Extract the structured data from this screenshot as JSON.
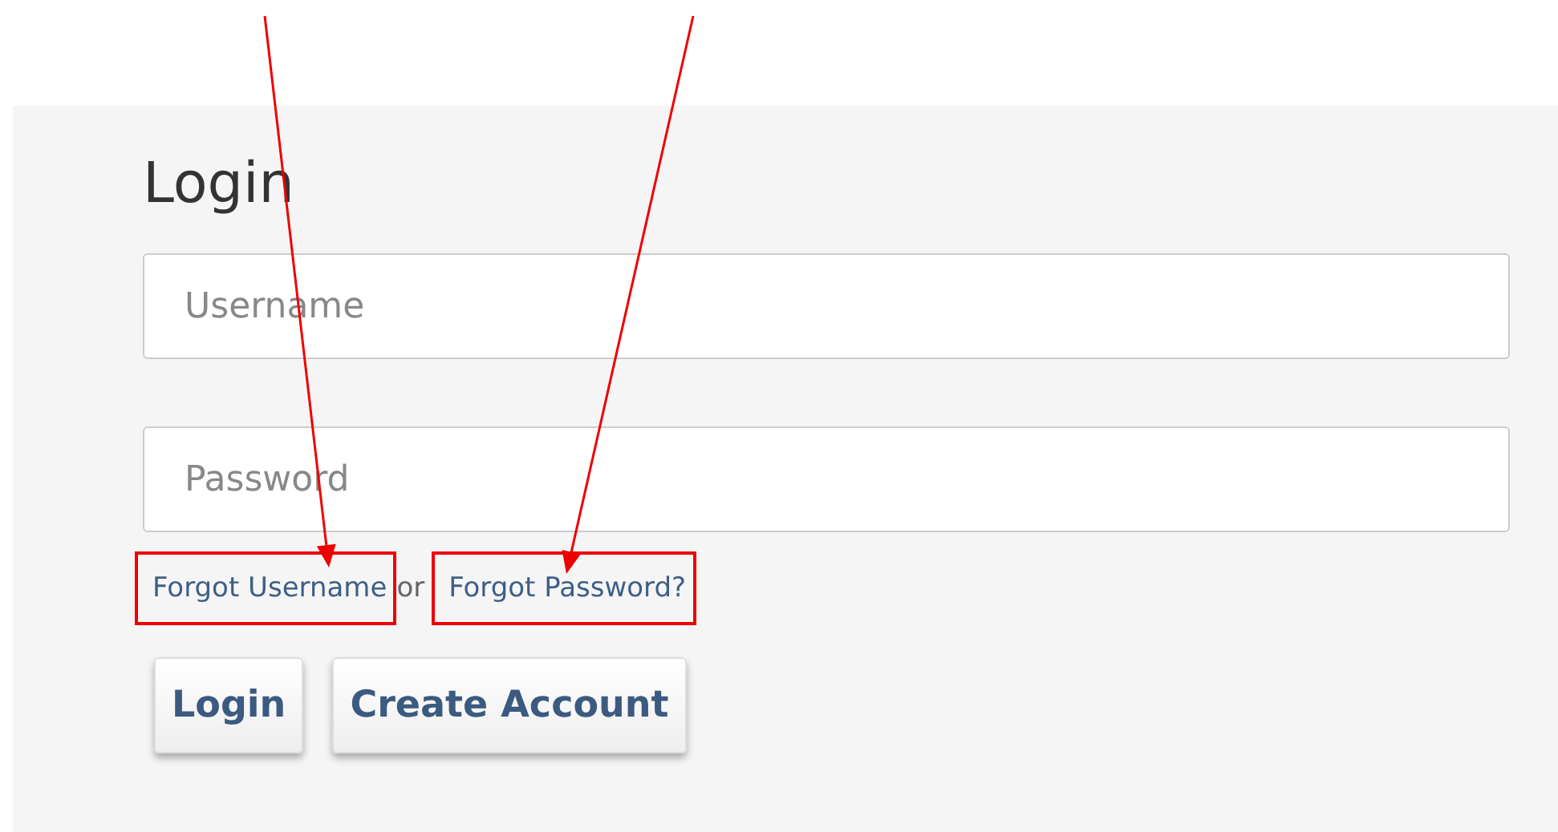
{
  "login_form": {
    "title": "Login",
    "fields": [
      {
        "placeholder": "Username"
      },
      {
        "placeholder": "Password"
      }
    ],
    "links": [
      {
        "label": "Forgot Username",
        "highlighted": true
      },
      {
        "label": "Forgot Password?",
        "highlighted": true
      }
    ],
    "separator": "or",
    "buttons": [
      "Login",
      "Create Account"
    ]
  }
}
